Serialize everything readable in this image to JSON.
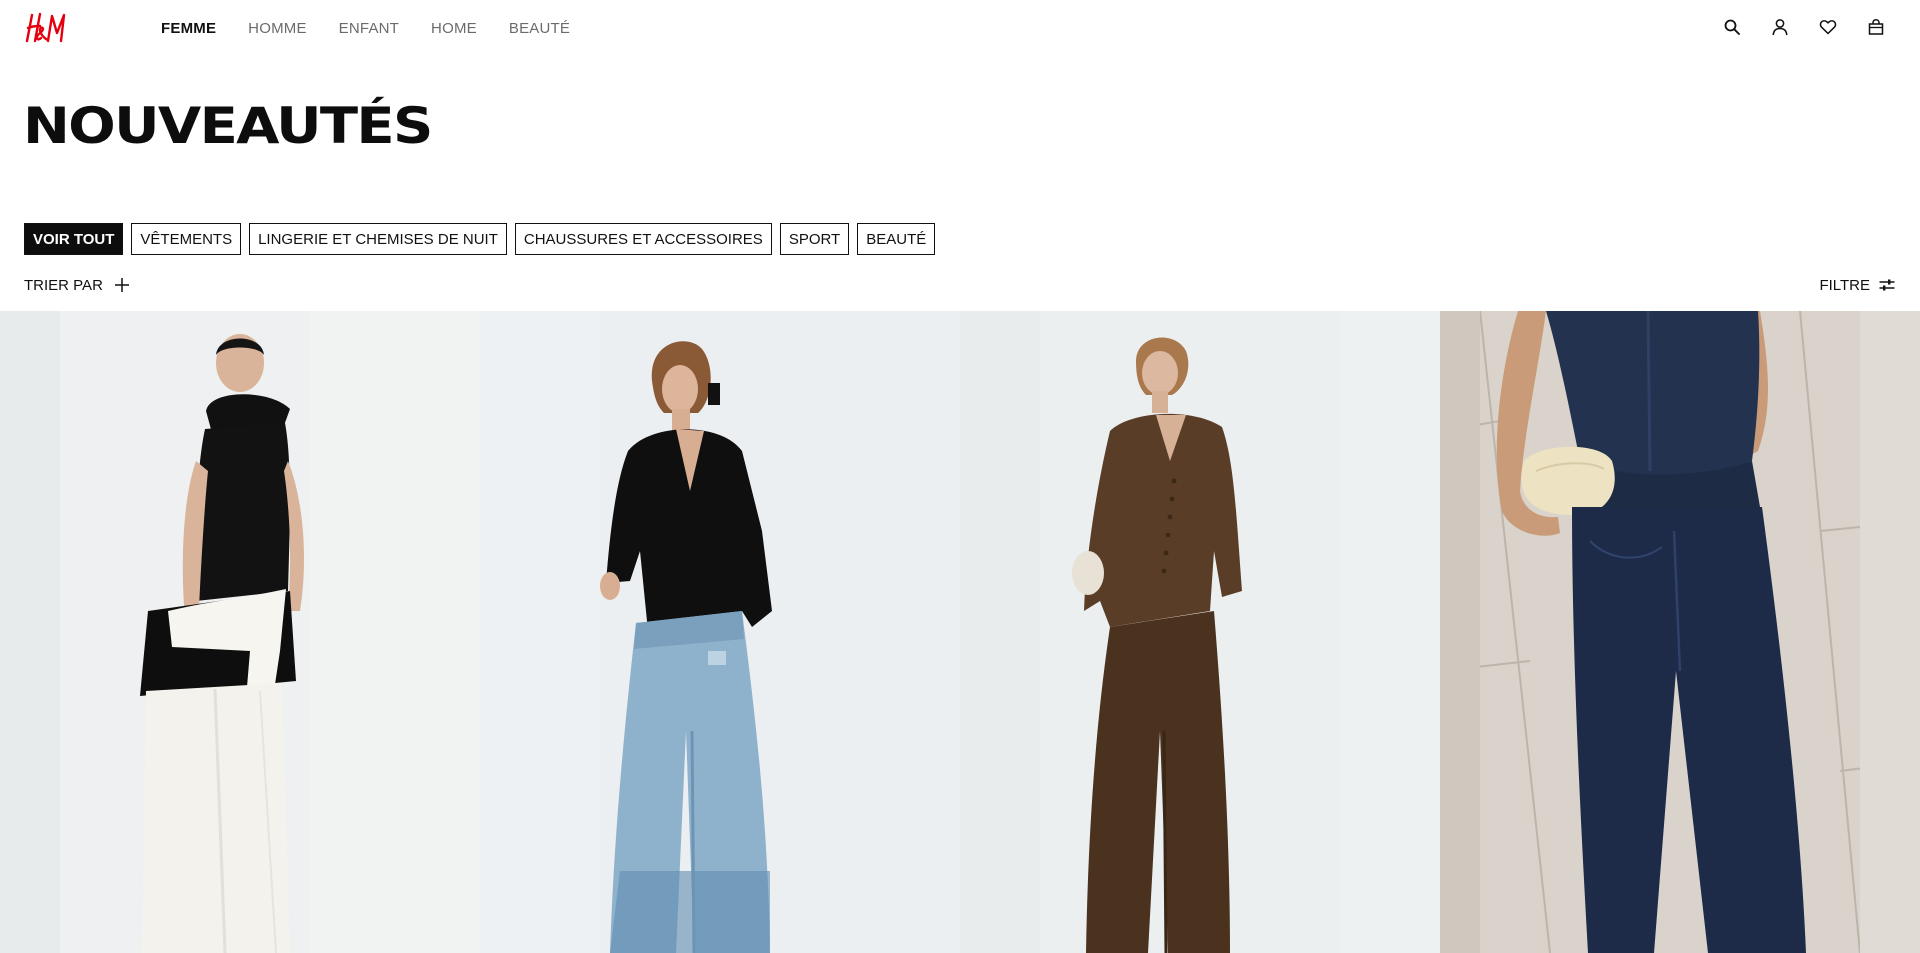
{
  "brand": {
    "logo_text": "H&M",
    "accent_color": "#e50010"
  },
  "nav": {
    "items": [
      {
        "label": "FEMME",
        "active": true
      },
      {
        "label": "HOMME",
        "active": false
      },
      {
        "label": "ENFANT",
        "active": false
      },
      {
        "label": "HOME",
        "active": false
      },
      {
        "label": "BEAUTÉ",
        "active": false
      }
    ]
  },
  "header_icons": [
    "search-icon",
    "account-icon",
    "heart-icon",
    "shopping-bag-icon"
  ],
  "page": {
    "title": "NOUVEAUTÉS"
  },
  "categories": [
    {
      "label": "VOIR TOUT",
      "active": true
    },
    {
      "label": "VÊTEMENTS",
      "active": false
    },
    {
      "label": "LINGERIE ET CHEMISES DE NUIT",
      "active": false
    },
    {
      "label": "CHAUSSURES ET ACCESSOIRES",
      "active": false
    },
    {
      "label": "SPORT",
      "active": false
    },
    {
      "label": "BEAUTÉ",
      "active": false
    }
  ],
  "toolbar": {
    "sort_label": "TRIER PAR",
    "filter_label": "FILTRE"
  },
  "products": [
    {
      "image": "model-black-top-white-skirt",
      "background": "#eef0f1"
    },
    {
      "image": "model-black-blouse-blue-jeans",
      "background": "#ebeff1"
    },
    {
      "image": "model-brown-suit",
      "background": "#eceff0"
    },
    {
      "image": "model-denim-top-jeans-clutch",
      "background": "#d9d3cb"
    }
  ]
}
